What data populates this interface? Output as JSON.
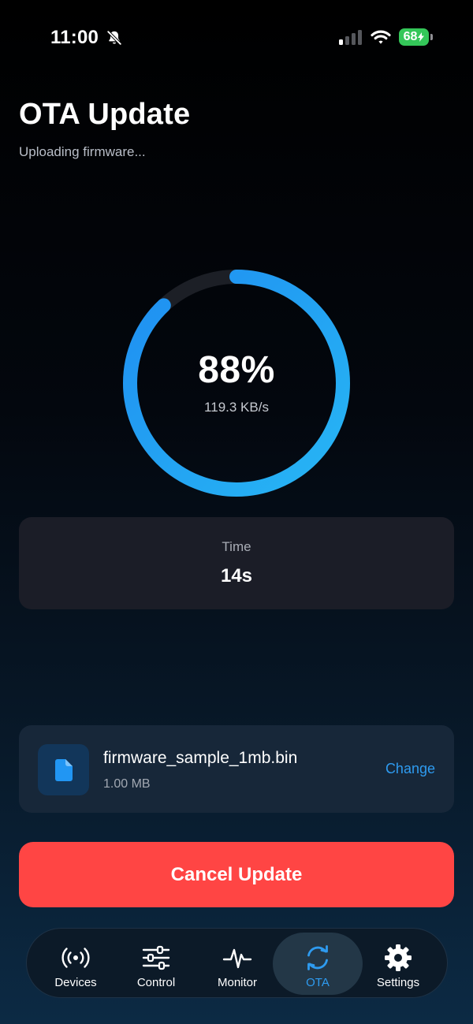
{
  "status_bar": {
    "time": "11:00",
    "battery": "68"
  },
  "header": {
    "title": "OTA Update",
    "subtitle": "Uploading firmware..."
  },
  "progress": {
    "percent_text": "88%",
    "fraction": 0.88,
    "speed": "119.3 KB/s"
  },
  "stats": {
    "time_label": "Time",
    "time_value": "14s"
  },
  "file": {
    "name": "firmware_sample_1mb.bin",
    "size": "1.00 MB",
    "change_label": "Change",
    "icon": "document-icon"
  },
  "actions": {
    "cancel_label": "Cancel Update"
  },
  "tabs": [
    {
      "label": "Devices",
      "icon": "antenna-icon",
      "active": false
    },
    {
      "label": "Control",
      "icon": "sliders-icon",
      "active": false
    },
    {
      "label": "Monitor",
      "icon": "waveform-icon",
      "active": false
    },
    {
      "label": "OTA",
      "icon": "sync-icon",
      "active": true
    },
    {
      "label": "Settings",
      "icon": "gear-icon",
      "active": false
    }
  ],
  "colors": {
    "accent": "#2e9bf0",
    "ring_start": "#27b6f4",
    "ring_end": "#1f8ef1",
    "ring_track": "#1c1f26",
    "danger": "#ff4544",
    "battery": "#34c759"
  }
}
